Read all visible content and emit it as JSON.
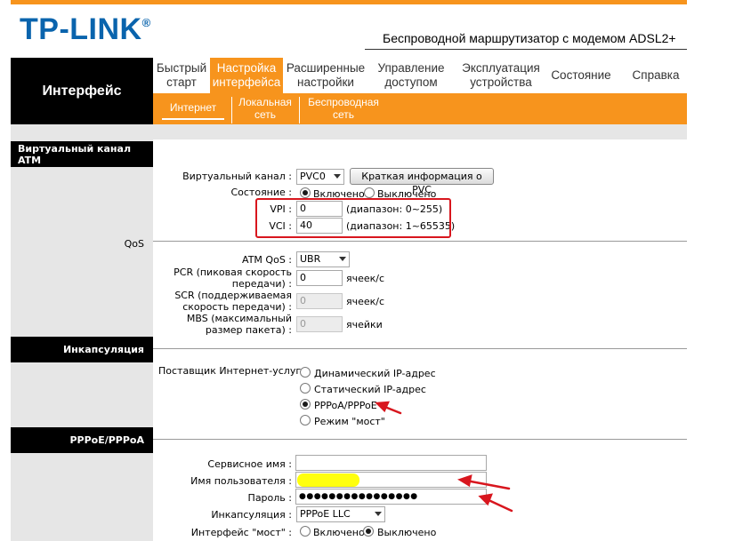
{
  "header": {
    "logo_text": "TP-LINK",
    "logo_mark": "®",
    "product_title": "Беспроводной маршрутизатор с модемом ADSL2+",
    "brand_color": "#0a64ad",
    "accent_color": "#f7941d"
  },
  "nav": {
    "section_title": "Интерфейс",
    "tabs": [
      {
        "label": "Быстрый\nстарт",
        "active": false
      },
      {
        "label": "Настройка\nинтерфейса",
        "active": true
      },
      {
        "label": "Расширенные\nнастройки",
        "active": false
      },
      {
        "label": "Управление\nдоступом",
        "active": false
      },
      {
        "label": "Эксплуатация\nустройства",
        "active": false
      },
      {
        "label": "Состояние",
        "active": false
      },
      {
        "label": "Справка",
        "active": false
      }
    ],
    "subtabs": [
      {
        "label": "Интернет",
        "selected": true
      },
      {
        "label": "Локальная\nсеть",
        "selected": false
      },
      {
        "label": "Беспроводная\nсеть",
        "selected": false
      }
    ]
  },
  "sections": {
    "atm": "Виртуальный канал ATM",
    "qos": "QoS",
    "encapsulation": "Инкапсуляция",
    "pppoe": "PPPoE/PPPoA"
  },
  "atm": {
    "vc_label": "Виртуальный канал :",
    "vc_value": "PVC0",
    "pvc_info_button": "Краткая информация о PVC",
    "status_label": "Состояние :",
    "status_on": "Включено",
    "status_off": "Выключено",
    "vpi_label": "VPI :",
    "vpi_value": "0",
    "vpi_range": "(диапазон: 0~255)",
    "vci_label": "VCI :",
    "vci_value": "40",
    "vci_range": "(диапазон: 1~65535)"
  },
  "qos": {
    "atm_qos_label": "ATM QoS :",
    "atm_qos_value": "UBR",
    "pcr_label": "PCR (пиковая скорость передачи) :",
    "pcr_value": "0",
    "pcr_unit": "ячеек/с",
    "scr_label": "SCR (поддерживаемая скорость передачи) :",
    "scr_value": "0",
    "scr_unit": "ячеек/с",
    "mbs_label": "MBS (максимальный размер пакета) :",
    "mbs_value": "0",
    "mbs_unit": "ячейки"
  },
  "encapsulation": {
    "isp_label": "Поставщик Интернет-услуг :",
    "options": [
      {
        "label": "Динамический IP-адрес",
        "selected": false
      },
      {
        "label": "Статический IP-адрес",
        "selected": false
      },
      {
        "label": "PPPoA/PPPoE",
        "selected": true
      },
      {
        "label": "Режим \"мост\"",
        "selected": false
      }
    ]
  },
  "pppoe": {
    "service_name_label": "Сервисное имя :",
    "service_name_value": "",
    "username_label": "Имя пользователя :",
    "username_value": "",
    "password_label": "Пароль :",
    "password_value": "●●●●●●●●●●●●●●●●",
    "encap_label": "Инкапсуляция :",
    "encap_value": "PPPoE LLC",
    "bridge_label": "Интерфейс \"мост\" :",
    "bridge_on": "Включено",
    "bridge_off": "Выключено"
  },
  "annotation_colors": {
    "box_red": "#d8161e",
    "highlight_yellow": "#ffff00"
  }
}
